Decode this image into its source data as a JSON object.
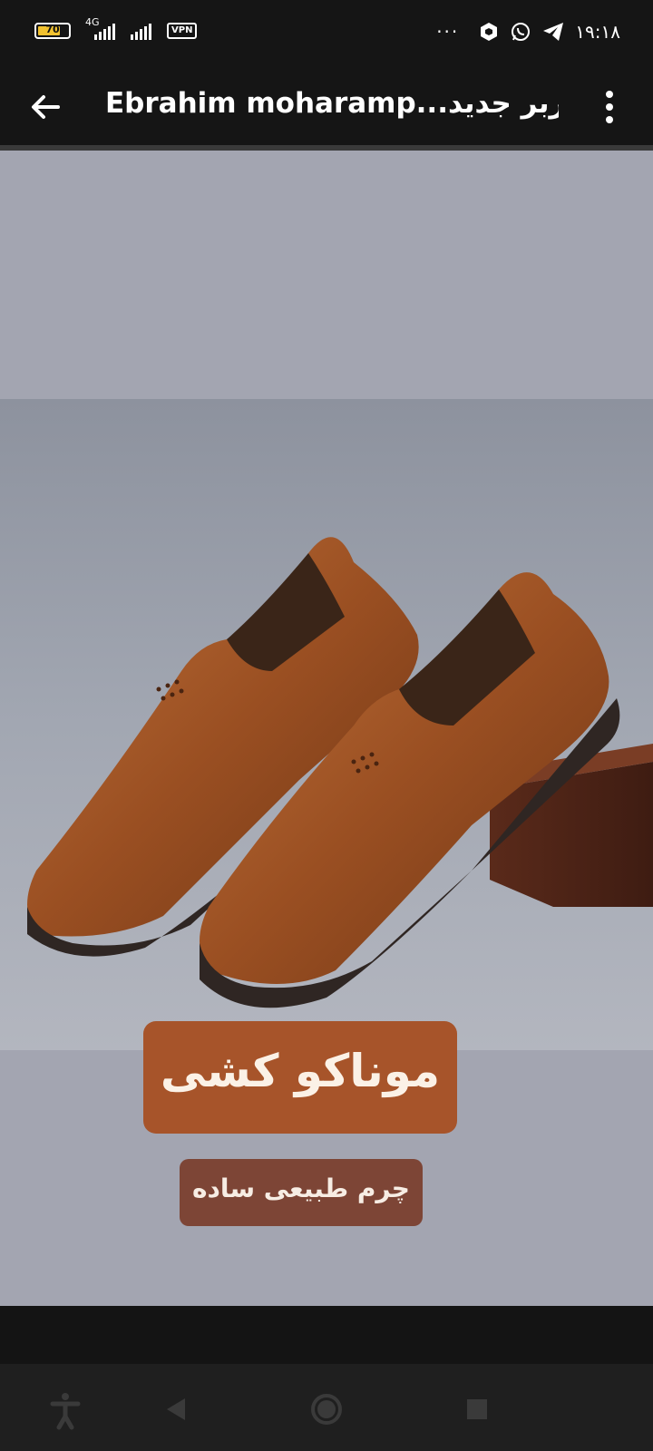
{
  "status_bar": {
    "battery_level": "70",
    "network_type": "4G",
    "vpn_label": "VPN",
    "overflow_dots": "···",
    "time": "۱۹:۱۸",
    "icons": [
      "battery-icon",
      "signal-icon",
      "vpn-icon",
      "notification-dots-icon",
      "hexagon-app-icon",
      "whatsapp-icon",
      "telegram-icon"
    ]
  },
  "app_bar": {
    "title": "Ebrahim moharamp...کاربر جدید",
    "back_icon": "arrow-left-icon",
    "menu_icon": "more-vertical-icon"
  },
  "image": {
    "description_icon": "shoes-photo",
    "product_name": "موناکو کشی",
    "product_detail": "چرم طبیعی ساده"
  },
  "colors": {
    "status_bar_bg": "#151515",
    "image_bg": "#a3a5b1",
    "title_badge": "#a7542a",
    "sub_badge": "#7d4536",
    "nav_bar_bg": "#1f1f1f"
  },
  "nav_bar": {
    "icons": [
      "accessibility-icon",
      "back-triangle-icon",
      "home-circle-icon",
      "recents-square-icon"
    ]
  }
}
